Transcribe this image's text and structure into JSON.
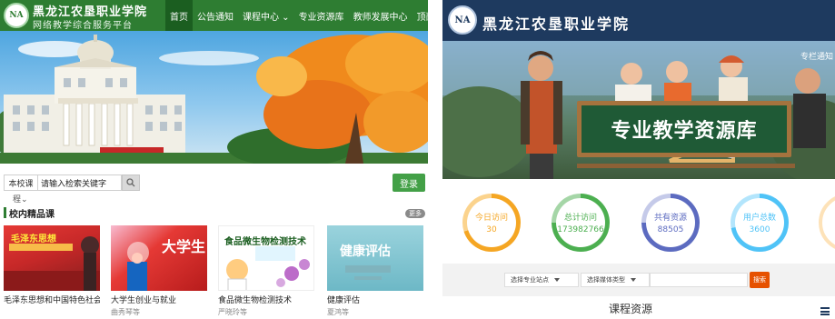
{
  "left": {
    "school_name": "黑龙江农垦职业学院",
    "platform_name": "网络教学综合服务平台",
    "logo_text": "NA",
    "nav": [
      {
        "label": "首页",
        "active": true
      },
      {
        "label": "公告通知",
        "active": false
      },
      {
        "label": "课程中心 ⌄",
        "active": false
      },
      {
        "label": "专业资源库",
        "active": false
      },
      {
        "label": "教师发展中心",
        "active": false
      },
      {
        "label": "顶岗实习",
        "active": false
      }
    ],
    "search": {
      "scope": "本校课",
      "placeholder": "请输入检索关键字",
      "extra": "程⌄"
    },
    "login": "登录",
    "section": {
      "title": "校内精品课",
      "more": "更多"
    },
    "courses": [
      {
        "title": "毛泽东思想和中国特色社会...",
        "teacher": "",
        "thumb_text": "毛泽东思想"
      },
      {
        "title": "大学生创业与就业",
        "teacher": "曲秀琴等",
        "thumb_text": "大学生"
      },
      {
        "title": "食品微生物检测技术",
        "teacher": "严晓玲等",
        "thumb_text": "食品微生物检测技术"
      },
      {
        "title": "健康评估",
        "teacher": "夏鸿等",
        "thumb_text": "健康评估"
      }
    ]
  },
  "right": {
    "school_name": "黑龙江农垦职业学院",
    "logo_text": "NA",
    "banner_title": "专业教学资源库",
    "top_right": "专栏通知",
    "stats": [
      {
        "label": "今日访问",
        "value": "30",
        "color": "#f5a623"
      },
      {
        "label": "总计访问",
        "value": "173982766",
        "color": "#4caf50"
      },
      {
        "label": "共有资源",
        "value": "88505",
        "color": "#5c6bc0"
      },
      {
        "label": "用户总数",
        "value": "3600",
        "color": "#4fc3f7"
      }
    ],
    "filter": {
      "major": "选择专业站点",
      "media": "选择媒体类型",
      "search_btn": "搜索"
    },
    "section_title": "课程资源"
  },
  "colors": {
    "left_brand": "#2e7d32",
    "right_brand": "#1e3a5f",
    "search_accent": "#e65100"
  }
}
